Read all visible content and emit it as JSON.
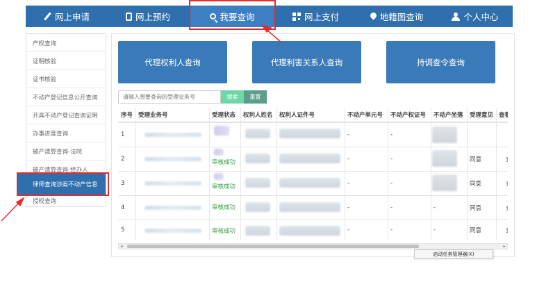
{
  "nav": {
    "items": [
      {
        "label": "网上申请",
        "icon": "pencil-icon"
      },
      {
        "label": "网上预约",
        "icon": "phone-icon"
      },
      {
        "label": "我要查询",
        "icon": "search-icon",
        "active": true
      },
      {
        "label": "网上支付",
        "icon": "qrcode-icon"
      },
      {
        "label": "地籍图查询",
        "icon": "map-pin-icon"
      },
      {
        "label": "个人中心",
        "icon": "user-icon"
      }
    ]
  },
  "sidebar": {
    "items": [
      {
        "label": "产权查询"
      },
      {
        "label": "证明核验"
      },
      {
        "label": "证书核验"
      },
      {
        "label": "不动产登记信息公开查询"
      },
      {
        "label": "开具不动产登记查询证明"
      },
      {
        "label": "办事进度查询"
      },
      {
        "label": "破产清算查询-法院"
      },
      {
        "label": "破产清算查询-经办人"
      },
      {
        "label": "律师查询涉案不动产信息",
        "active": true
      },
      {
        "label": "授权查询"
      }
    ]
  },
  "query_buttons": [
    {
      "label": "代理权利人查询"
    },
    {
      "label": "代理利害关系人查询"
    },
    {
      "label": "持调查令查询"
    }
  ],
  "search": {
    "placeholder": "请输入想要查询的受理业务号",
    "search_label": "搜索",
    "reset_label": "重置"
  },
  "table": {
    "columns": [
      "序号",
      "受理业务号",
      "受理状态",
      "权利人姓名",
      "权利人证件号",
      "不动产单元号",
      "不动产权证号",
      "不动产坐落",
      "受理意见",
      "查看"
    ],
    "rows": [
      {
        "no": "1",
        "status": "",
        "unit_no": "-",
        "cert_no": "-",
        "opinion": "",
        "view": ""
      },
      {
        "no": "2",
        "status": "审核成功",
        "unit_no": "-",
        "cert_no": "-",
        "opinion": "同意",
        "view": "查"
      },
      {
        "no": "3",
        "status": "审核成功",
        "unit_no": "-",
        "cert_no": "-",
        "opinion": "同意",
        "view": "查"
      },
      {
        "no": "4",
        "status": "审核成功",
        "unit_no": "-",
        "cert_no": "-",
        "location": "-",
        "opinion": "同意",
        "view": "查"
      },
      {
        "no": "5",
        "status": "审核成功",
        "unit_no": "-",
        "cert_no": "-",
        "location": "-",
        "opinion": "同意",
        "view": "查"
      }
    ]
  },
  "scrollbar": {
    "left_arrow": "◂",
    "right_arrow": "▸"
  },
  "tooltip": {
    "text": "启动任务管理器(K)"
  },
  "colors": {
    "nav_bg": "#2f6fad",
    "button_bg": "#3a7ab8",
    "highlight": "#e02e2e",
    "success": "#2e9a3e",
    "search_btn": "#6fd6a5",
    "reset_btn": "#5b9e8b"
  }
}
